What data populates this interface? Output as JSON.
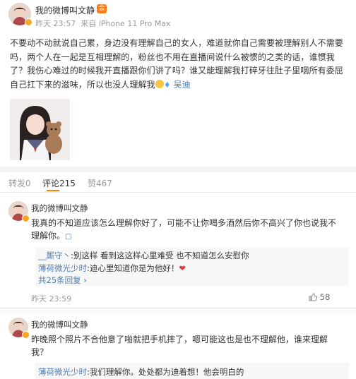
{
  "post": {
    "author": "我的微博叫文静",
    "vip_badge": "会",
    "time": "昨天 23:57",
    "source": "来自 iPhone 11 Pro Max",
    "text_main": "不要动不动就说自己累，身边没有理解自己的女人，难道就你自己需要被理解别人不需要吗，两个人在一起是互相理解的，粉丝也不用在直播间说什么被惯的之类的话，谁惯我了？我伤心难过的时候我开直播跟你们讲了吗？谁又能理解我打碎牙往肚子里咽所有委屈自己扛下来的滋味，所以也没人理解我",
    "mention": "吴迪"
  },
  "tabs": {
    "repost": "转发0",
    "comment": "评论215",
    "like": "赞467"
  },
  "comments": [
    {
      "author": "我的微博叫文静",
      "text": "我真的不知道应该怎么理解你好了，可能不让你喝多酒然后你不高兴了你也说我不理解你。",
      "mark": "□",
      "time": "昨天 23:59",
      "likes": "58",
      "replies": [
        {
          "who": "__厮守丶",
          "text": ":别这样 看到这这样心里难受 也不知道怎么安慰你"
        },
        {
          "who": "薄荷微光少时",
          "text": ":迪心里知道你是为他好！"
        }
      ],
      "more": "共25条回复 ›"
    },
    {
      "author": "我的微博叫文静",
      "text": "昨晚照个照片不合他意了啪就把手机摔了，嗯可能这也是也不理解他，谁来理解我？",
      "replies": [
        {
          "who": "薄荷微光少时",
          "text": ":我们理解你。处处都为迪着想！他会明白的"
        }
      ]
    }
  ],
  "icons": {
    "verified": "verified-badge-icon",
    "like": "thumb-up-icon",
    "emoji": "smile-emoji-icon",
    "diamond": "diamond-icon",
    "heart": "heart-icon"
  },
  "colors": {
    "link": "#507daf",
    "accent": "#ff8200",
    "heart": "#e0383e"
  }
}
